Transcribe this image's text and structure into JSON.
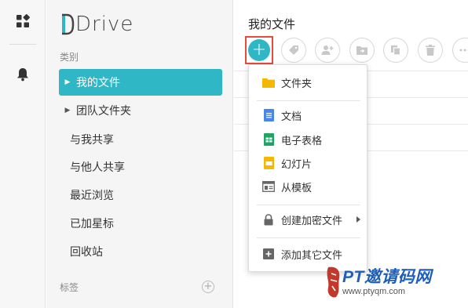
{
  "app": {
    "logo_text": "Drive"
  },
  "sidebar": {
    "category_label": "类别",
    "items": [
      {
        "label": "我的文件",
        "active": true,
        "has_caret": true
      },
      {
        "label": "团队文件夹",
        "active": false,
        "has_caret": true
      },
      {
        "label": "与我共享",
        "active": false,
        "has_caret": false
      },
      {
        "label": "与他人共享",
        "active": false,
        "has_caret": false
      },
      {
        "label": "最近浏览",
        "active": false,
        "has_caret": false
      },
      {
        "label": "已加星标",
        "active": false,
        "has_caret": false
      },
      {
        "label": "回收站",
        "active": false,
        "has_caret": false
      }
    ],
    "tags_label": "标签"
  },
  "main": {
    "title": "我的文件",
    "toolbar": [
      "add",
      "tag",
      "share-user",
      "move-to-folder",
      "copy",
      "delete",
      "more"
    ]
  },
  "dropdown": {
    "items": [
      {
        "label": "文件夹",
        "icon": "folder-icon",
        "color": "#f5b800"
      },
      {
        "label": "文档",
        "icon": "document-icon",
        "color": "#4a86e8"
      },
      {
        "label": "电子表格",
        "icon": "spreadsheet-icon",
        "color": "#1fa463"
      },
      {
        "label": "幻灯片",
        "icon": "slides-icon",
        "color": "#f5b800"
      },
      {
        "label": "从模板",
        "icon": "template-icon",
        "color": "#666666"
      },
      {
        "label": "创建加密文件",
        "icon": "lock-icon",
        "color": "#666666"
      },
      {
        "label": "添加其它文件",
        "icon": "add-file-icon",
        "color": "#666666"
      }
    ]
  },
  "watermark": {
    "title": "PT邀请码网",
    "url": "www.ptyqm.com"
  },
  "colors": {
    "accent": "#30b7c5",
    "highlight_border": "#e84b3c"
  }
}
